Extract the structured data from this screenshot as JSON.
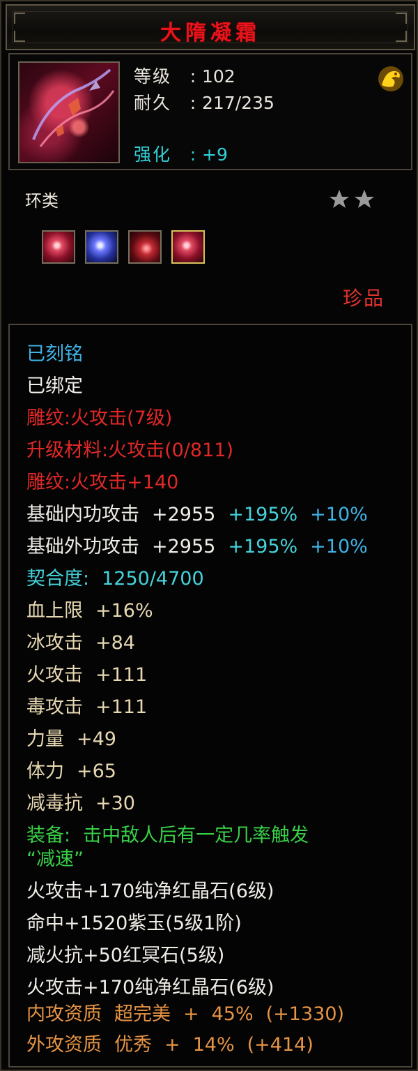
{
  "title": "大隋凝霜",
  "header": {
    "level_label": "等级",
    "level_value": "102",
    "durability_label": "耐久",
    "durability_value": "217/235",
    "enhance_label": "强化",
    "enhance_value": "+9",
    "separator": ":"
  },
  "category": "环类",
  "star_count": 2,
  "gems": [
    {
      "name": "red-gem-icon"
    },
    {
      "name": "blue-gem-icon"
    },
    {
      "name": "red-crystal-icon"
    },
    {
      "name": "red-gem-icon",
      "selected": true
    }
  ],
  "rarity": "珍品",
  "attributes": {
    "engraved": "已刻铭",
    "bound": "已绑定",
    "carving1": "雕纹:火攻击(7级)",
    "upgrade_material": "升级材料:火攻击(0/811)",
    "carving2": "雕纹:火攻击+140",
    "inner_attack": {
      "label": "基础内功攻击",
      "value": "+2955",
      "pct1": "+195%",
      "pct2": "+10%"
    },
    "outer_attack": {
      "label": "基础外功攻击",
      "value": "+2955",
      "pct1": "+195%",
      "pct2": "+10%"
    },
    "fit": {
      "label": "契合度:",
      "value": "1250/4700"
    },
    "stats": [
      {
        "label": "血上限",
        "value": "+16%"
      },
      {
        "label": "冰攻击",
        "value": "+84"
      },
      {
        "label": "火攻击",
        "value": "+111"
      },
      {
        "label": "毒攻击",
        "value": "+111"
      },
      {
        "label": "力量",
        "value": "+49"
      },
      {
        "label": "体力",
        "value": "+65"
      },
      {
        "label": "减毒抗",
        "value": "+30"
      }
    ],
    "equip_label": "装备:",
    "equip_effect_1": "击中敌人后有一定几率触发",
    "equip_effect_2": "“减速”",
    "sockets": [
      "火攻击+170纯净红晶石(6级)",
      "命中+1520紫玉(5级1阶)",
      "减火抗+50红冥石(5级)",
      "火攻击+170纯净红晶石(6级)"
    ],
    "inner_quality": {
      "label": "内攻资质",
      "grade": "超完美",
      "plus": "+",
      "pct": "45%",
      "bonus": "(+1330)"
    },
    "outer_quality": {
      "label": "外攻资质",
      "grade": "优秀",
      "plus": "+",
      "pct": "14%",
      "bonus": "(+414)"
    }
  },
  "colors": {
    "title": "#e8141b",
    "enhance": "#33d0d8",
    "rarity": "#e3332d",
    "blue_text": "#3fb4e6",
    "red_text": "#e12828",
    "green_text": "#38d048",
    "orange_text": "#e69445"
  }
}
